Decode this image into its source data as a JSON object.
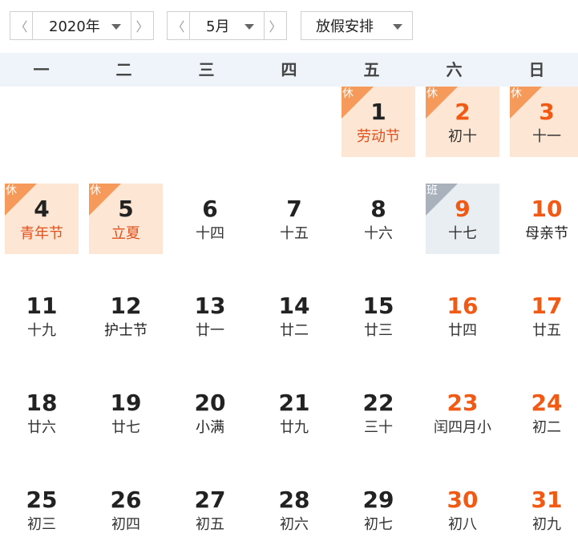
{
  "toolbar": {
    "year": "2020年",
    "month": "5月",
    "mode": "放假安排",
    "prev_glyph": "〈",
    "next_glyph": "〉"
  },
  "weekdays": [
    "一",
    "二",
    "三",
    "四",
    "五",
    "六",
    "日"
  ],
  "tags": {
    "holiday": "休",
    "workday": "班"
  },
  "colors": {
    "weekend": "#f05a14",
    "holiday_bg": "#fde6d4",
    "holiday_tag": "#f59a5b",
    "workday_bg": "#e9eef3",
    "workday_tag": "#a9b2bc",
    "header_bg": "#eef4fa"
  },
  "weeks": [
    [
      null,
      null,
      null,
      null,
      {
        "num": "1",
        "lunar": "劳动节",
        "type": "holiday",
        "fest": true
      },
      {
        "num": "2",
        "lunar": "初十",
        "type": "holiday",
        "weekend": true
      },
      {
        "num": "3",
        "lunar": "十一",
        "type": "holiday",
        "weekend": true
      }
    ],
    [
      {
        "num": "4",
        "lunar": "青年节",
        "type": "holiday",
        "fest": true
      },
      {
        "num": "5",
        "lunar": "立夏",
        "type": "holiday",
        "fest": true
      },
      {
        "num": "6",
        "lunar": "十四"
      },
      {
        "num": "7",
        "lunar": "十五"
      },
      {
        "num": "8",
        "lunar": "十六"
      },
      {
        "num": "9",
        "lunar": "十七",
        "type": "workday"
      },
      {
        "num": "10",
        "lunar": "母亲节",
        "weekend": true,
        "festblack": true
      }
    ],
    [
      {
        "num": "11",
        "lunar": "十九"
      },
      {
        "num": "12",
        "lunar": "护士节",
        "festblack": true
      },
      {
        "num": "13",
        "lunar": "廿一"
      },
      {
        "num": "14",
        "lunar": "廿二"
      },
      {
        "num": "15",
        "lunar": "廿三"
      },
      {
        "num": "16",
        "lunar": "廿四",
        "weekend": true
      },
      {
        "num": "17",
        "lunar": "廿五",
        "weekend": true
      }
    ],
    [
      {
        "num": "18",
        "lunar": "廿六"
      },
      {
        "num": "19",
        "lunar": "廿七"
      },
      {
        "num": "20",
        "lunar": "小满",
        "festblack": true
      },
      {
        "num": "21",
        "lunar": "廿九"
      },
      {
        "num": "22",
        "lunar": "三十"
      },
      {
        "num": "23",
        "lunar": "闰四月小",
        "weekend": true
      },
      {
        "num": "24",
        "lunar": "初二",
        "weekend": true
      }
    ],
    [
      {
        "num": "25",
        "lunar": "初三"
      },
      {
        "num": "26",
        "lunar": "初四"
      },
      {
        "num": "27",
        "lunar": "初五"
      },
      {
        "num": "28",
        "lunar": "初六"
      },
      {
        "num": "29",
        "lunar": "初七"
      },
      {
        "num": "30",
        "lunar": "初八",
        "weekend": true
      },
      {
        "num": "31",
        "lunar": "初九",
        "weekend": true
      }
    ]
  ]
}
